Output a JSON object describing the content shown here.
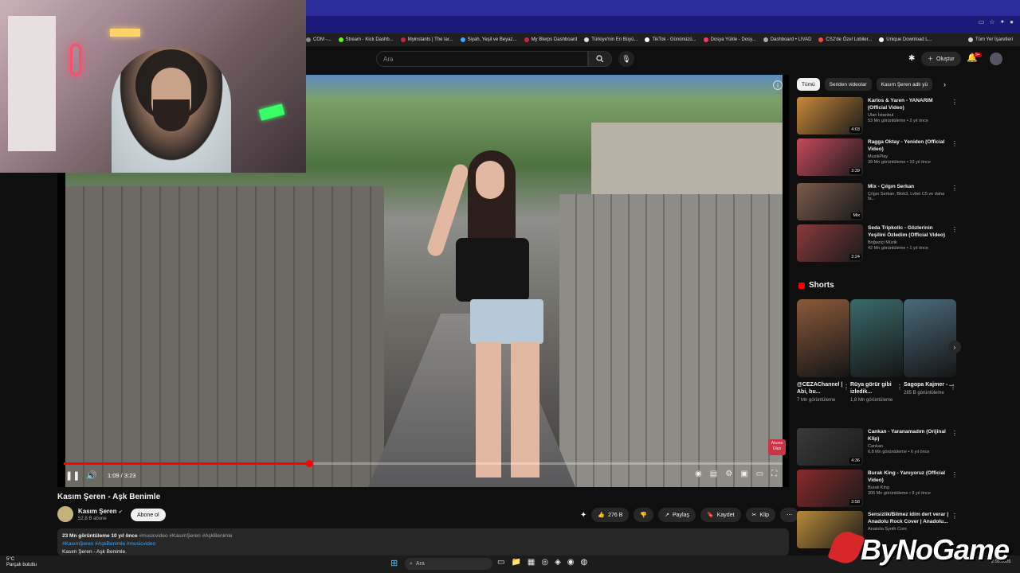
{
  "bookmarks": [
    {
      "label": "COM -...",
      "color": "#888888"
    },
    {
      "label": "Stream - Kick Dashb...",
      "color": "#53fc18"
    },
    {
      "label": "Myinstants | The lar...",
      "color": "#cc2244"
    },
    {
      "label": "Siyah, Yeşil ve Beyaz...",
      "color": "#3ea6ff"
    },
    {
      "label": "My Blerps Dashboard",
      "color": "#cc2244"
    },
    {
      "label": "Türkiye'nin En Büyü...",
      "color": "#dddddd"
    },
    {
      "label": "TikTok - Gününüzü...",
      "color": "#ffffff"
    },
    {
      "label": "Dosya Yükle - Dosy...",
      "color": "#ff3366"
    },
    {
      "label": "Dashboard • LIVAD",
      "color": "#aaaaaa"
    },
    {
      "label": "CS2'de Özel Lobiler...",
      "color": "#ff4444"
    },
    {
      "label": "Unique Download L...",
      "color": "#ffffff"
    },
    {
      "label": "Tüm Yer İşaretleri",
      "color": "#cccccc"
    }
  ],
  "header": {
    "search_placeholder": "Ara",
    "create_label": "Oluştur",
    "notification_count": "9+"
  },
  "player": {
    "time": "1:09 / 3:23",
    "progress": 0.342,
    "subscribe_watermark": "Abone Olun"
  },
  "video": {
    "title": "Kasım Şeren - Aşk Benimle",
    "channel": "Kasım Şeren",
    "subscribers": "52,8 B abone",
    "subscribe_label": "Abone ol",
    "likes": "276 B",
    "share_label": "Paylaş",
    "save_label": "Kaydet",
    "clip_label": "Klip",
    "stats": "23 Mn görüntüleme  10 yıl önce",
    "stat_tags": "#musicvideo #KasımŞeren #AşkBenimle",
    "hashtags": "#KasımŞeren #AşkBenimle #musicvideo",
    "desc_line": "Kasım Şeren - Aşk Benimle."
  },
  "chips": [
    "Tümü",
    "Seriden videolar",
    "Kasım Şeren adlı yü"
  ],
  "recommendations": [
    {
      "title": "Karlos & Yaren - YANARIM (Official Video)",
      "channel": "Ulan İstanbul",
      "views": "53 Mn görüntüleme • 2 yıl önce",
      "duration": "4:03",
      "color": "#c9893a"
    },
    {
      "title": "Ragga Oktay - Yeniden (Official Video)",
      "channel": "MuzikPlay",
      "views": "39 Mn görüntüleme • 10 yıl önce",
      "duration": "3:39",
      "color": "#c64a5a"
    },
    {
      "title": "Mix - Çılgın Serkan",
      "channel": "Çılgın Serkan, Blok3, Lvbel C5 ve daha fa...",
      "views": "",
      "duration": "Mix",
      "color": "#7a5c4a"
    },
    {
      "title": "Seda Tripkolic - Gözlerinin Yeşilini Özledim (Official Video)",
      "channel": "Boğaziçi Müzik",
      "views": "42 Mn görüntüleme • 1 yıl önce",
      "duration": "3:24",
      "color": "#8a3a3a"
    },
    {
      "title": "Cankan - Yaranamadım (Orijinal Klip)",
      "channel": "Cankan",
      "views": "6,8 Mn görüntüleme • 6 yıl önce",
      "duration": "4:36",
      "color": "#3a3a3a"
    },
    {
      "title": "Burak King - Yanıyoruz (Official Video)",
      "channel": "Burak King",
      "views": "306 Mn görüntüleme • 9 yıl önce",
      "duration": "3:58",
      "color": "#8a2a2a"
    },
    {
      "title": "Sensizlik/Bilmez idim dert verar | Anadolu Rock Cover | Anadolu...",
      "channel": "Anatolia Synth Core",
      "views": "",
      "duration": "",
      "color": "#b88a3a"
    }
  ],
  "shorts": {
    "title": "Shorts",
    "items": [
      {
        "title": "@CEZAChannel | Abi, bu...",
        "views": "7 Mn görüntüleme",
        "color": "#8a5a3a"
      },
      {
        "title": "Rüya görür gibi izledik...",
        "views": "1,8 Mn görüntüleme",
        "color": "#3a6a6a"
      },
      {
        "title": "Sagopa Kajmer - ...",
        "views": "285 B görüntüleme",
        "color": "#4a6a7a"
      }
    ]
  },
  "taskbar": {
    "temp": "5°C",
    "weather": "Parçalı bulutlu",
    "search": "Ara",
    "time": "2.03.2026"
  },
  "watermark": "ByNoGame"
}
